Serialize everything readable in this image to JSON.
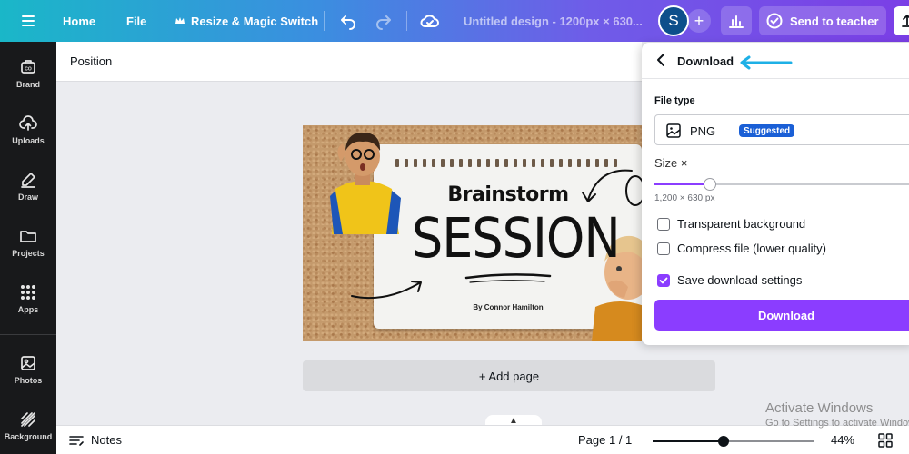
{
  "topbar": {
    "home": "Home",
    "file": "File",
    "resize": "Resize & Magic Switch",
    "title": "Untitled design - 1200px × 630...",
    "avatar_letter": "S",
    "send": "Send to teacher"
  },
  "sidebar": {
    "items": [
      {
        "label": "Brand",
        "icon": "brand-icon"
      },
      {
        "label": "Uploads",
        "icon": "upload-cloud-icon"
      },
      {
        "label": "Draw",
        "icon": "pen-icon"
      },
      {
        "label": "Projects",
        "icon": "folder-icon"
      },
      {
        "label": "Apps",
        "icon": "apps-grid-icon"
      },
      {
        "label": "Photos",
        "icon": "image-icon"
      },
      {
        "label": "Background",
        "icon": "background-pattern-icon"
      }
    ]
  },
  "toolbar": {
    "position": "Position"
  },
  "design": {
    "heading_small": "Brainstorm",
    "heading_big": "SESSION",
    "byline": "By Connor Hamilton"
  },
  "canvas": {
    "add_page": "+ Add page"
  },
  "bottombar": {
    "notes": "Notes",
    "page": "Page 1 / 1",
    "zoom": "44%",
    "zoom_fraction": 0.44
  },
  "download_panel": {
    "title": "Download",
    "file_type_label": "File type",
    "file_type": "PNG",
    "suggested_badge": "Suggested",
    "size_label": "Size ×",
    "size_fraction": 0.21,
    "dimensions": "1,200 × 630 px",
    "options": [
      {
        "label": "Transparent background",
        "checked": false
      },
      {
        "label": "Compress file (lower quality)",
        "checked": false
      },
      {
        "label": "Save download settings",
        "checked": true
      }
    ],
    "download_button": "Download"
  },
  "watermark": {
    "line1": "Activate Windows",
    "line2": "Go to Settings to activate Windows."
  },
  "colors": {
    "accent_purple": "#8b3dff",
    "badge_blue": "#1a5fd6",
    "annotation_arrow": "#1eb0e6"
  }
}
